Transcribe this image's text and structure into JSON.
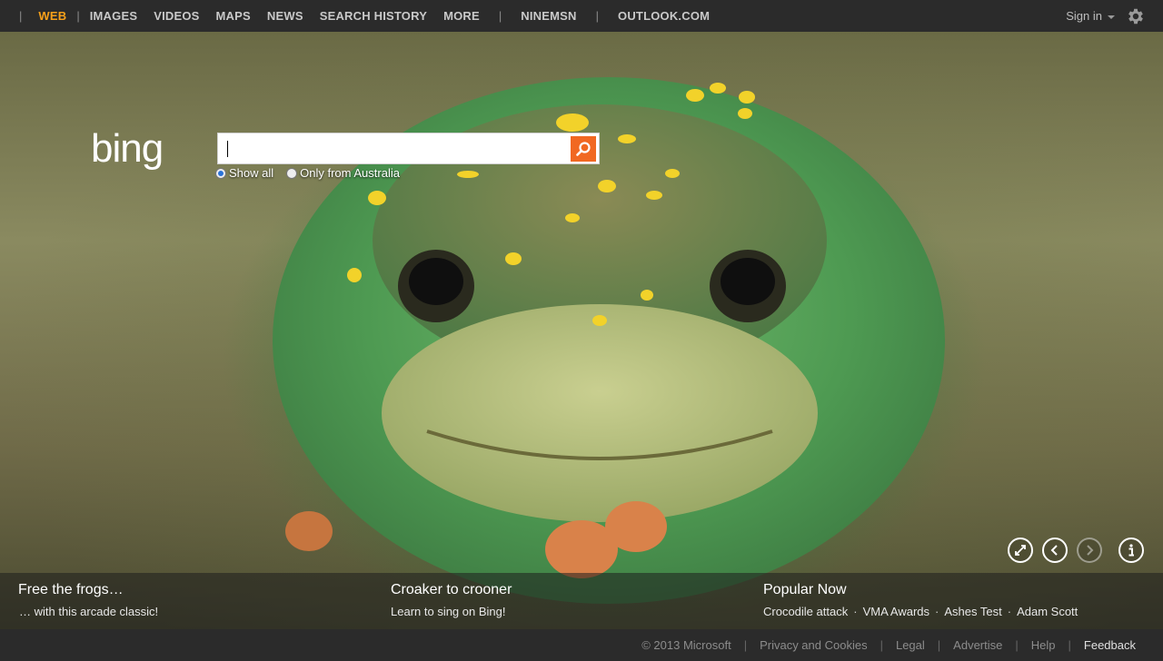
{
  "nav": {
    "items": [
      {
        "label": "WEB",
        "active": true
      },
      {
        "label": "IMAGES"
      },
      {
        "label": "VIDEOS"
      },
      {
        "label": "MAPS"
      },
      {
        "label": "NEWS"
      },
      {
        "label": "SEARCH HISTORY"
      },
      {
        "label": "MORE"
      }
    ],
    "extra": [
      "NINEMSN",
      "OUTLOOK.COM"
    ],
    "signin_label": "Sign in",
    "settings_icon": "gear-icon"
  },
  "search": {
    "logo": "bing",
    "value": "",
    "button_icon": "search-icon",
    "scope_all": "Show all",
    "scope_local": "Only from Australia",
    "scope_selected": "Show all"
  },
  "controls": {
    "icons": [
      "fullscreen-icon",
      "previous-icon",
      "next-icon",
      "info-icon"
    ]
  },
  "captions": {
    "left_title": "Free the frogs…",
    "left_sub": "… with this arcade classic!",
    "mid_title": "Croaker to crooner",
    "mid_sub": "Learn to sing on Bing!",
    "popular_title": "Popular Now",
    "popular_links": [
      "Crocodile attack",
      "VMA Awards",
      "Ashes Test",
      "Adam Scott"
    ]
  },
  "footer": {
    "copyright": "© 2013 Microsoft",
    "links": [
      "Privacy and Cookies",
      "Legal",
      "Advertise",
      "Help"
    ],
    "feedback": "Feedback"
  },
  "colors": {
    "accent": "#f6a01a",
    "search_button": "#f16822",
    "bar": "#2b2b2b"
  }
}
